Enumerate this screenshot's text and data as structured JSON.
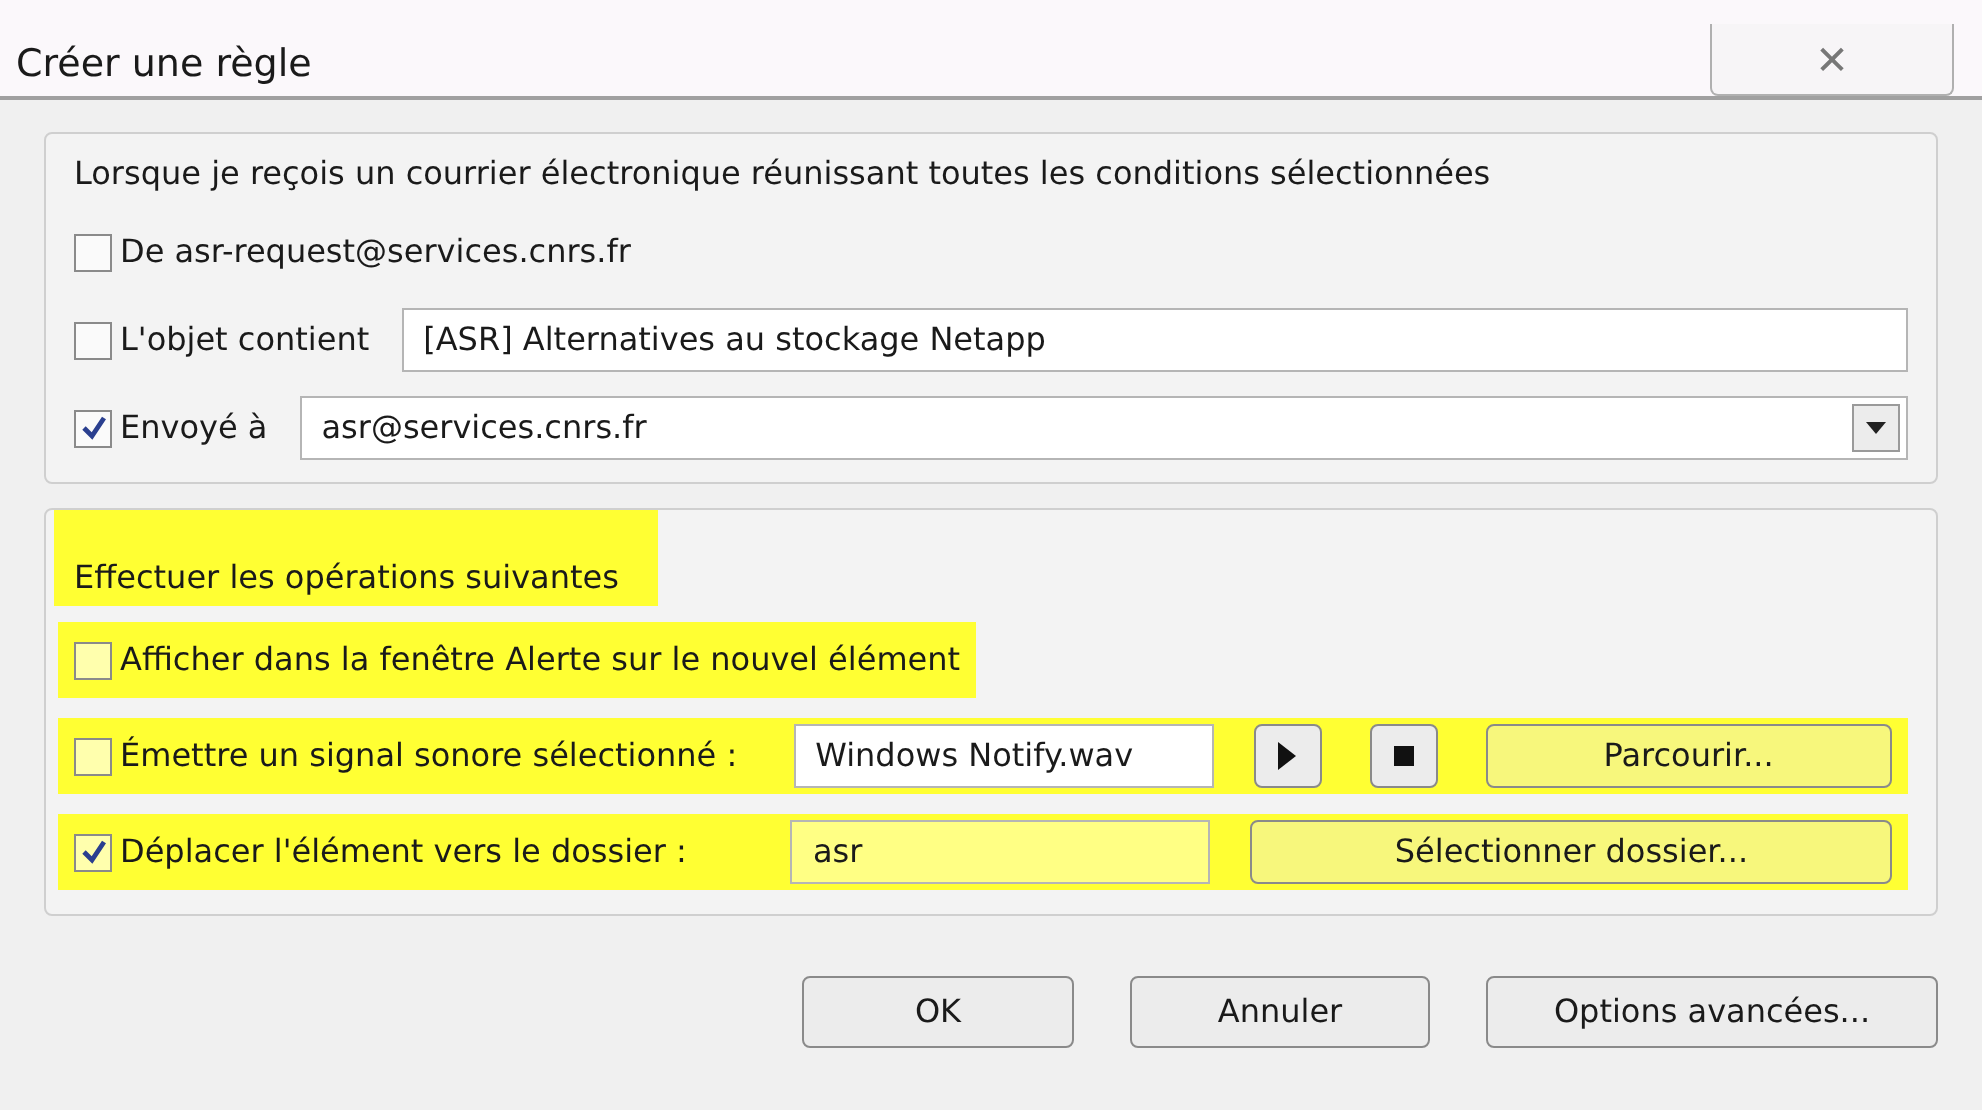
{
  "window": {
    "title": "Créer une règle",
    "close": "✕"
  },
  "conditions": {
    "heading": "Lorsque je reçois un courrier électronique réunissant toutes les conditions sélectionnées",
    "rows": [
      {
        "kind": "plain",
        "label": "De asr-request@services.cnrs.fr",
        "checked": false
      },
      {
        "kind": "text",
        "label": "L'objet contient",
        "checked": false,
        "value": "[ASR] Alternatives au stockage Netapp"
      },
      {
        "kind": "combo",
        "label": "Envoyé à",
        "checked": true,
        "value": "asr@services.cnrs.fr"
      }
    ]
  },
  "actions": {
    "heading": "Effectuer les opérations suivantes",
    "highlighted": true,
    "rows": [
      {
        "kind": "plain",
        "label": "Afficher dans la fenêtre Alerte sur le nouvel élément",
        "checked": false,
        "highlighted": true
      },
      {
        "kind": "sound",
        "label": "Émettre un signal sonore sélectionné :",
        "checked": false,
        "highlighted": true,
        "value": "Windows Notify.wav",
        "button": "Parcourir..."
      },
      {
        "kind": "folder",
        "label": "Déplacer l'élément vers le dossier :",
        "checked": true,
        "highlighted": true,
        "value": "asr",
        "button": "Sélectionner dossier..."
      }
    ]
  },
  "buttons": [
    "OK",
    "Annuler",
    "Options avancées..."
  ]
}
